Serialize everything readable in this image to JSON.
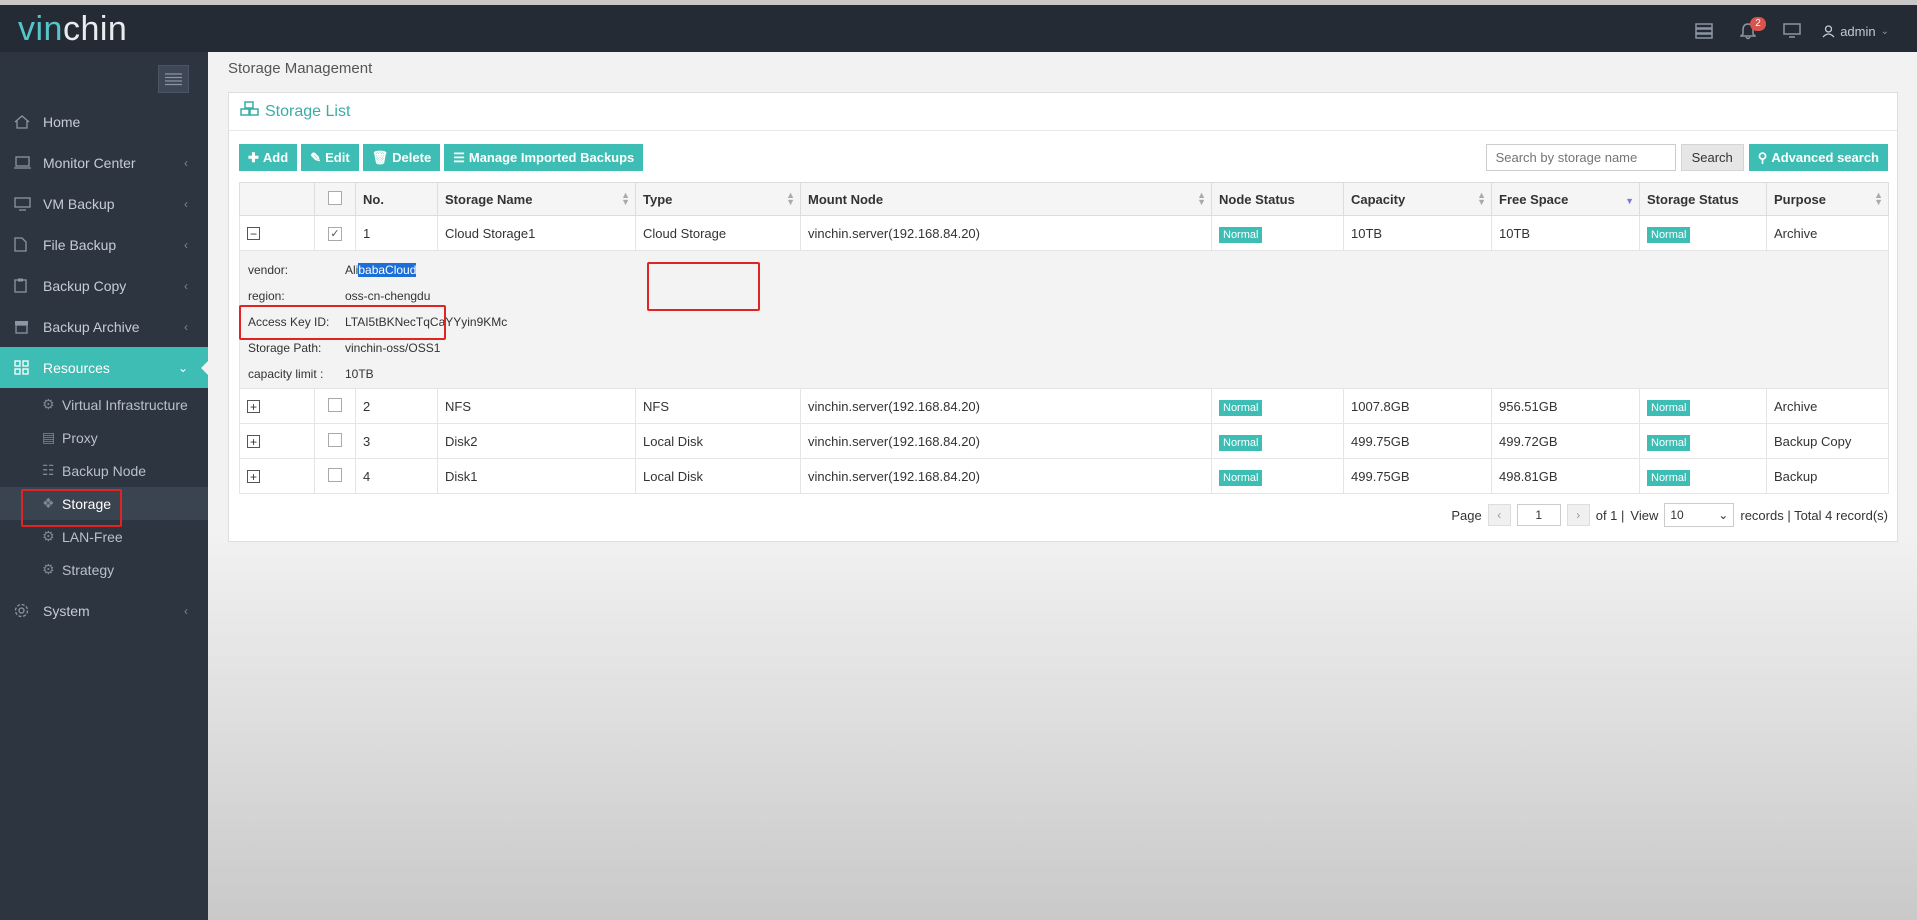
{
  "brand": {
    "part1": "vin",
    "part2": "chin"
  },
  "topbar": {
    "notification_count": "2",
    "user": "admin"
  },
  "sidebar": {
    "items": [
      {
        "label": "Home"
      },
      {
        "label": "Monitor Center"
      },
      {
        "label": "VM Backup"
      },
      {
        "label": "File Backup"
      },
      {
        "label": "Backup Copy"
      },
      {
        "label": "Backup Archive"
      },
      {
        "label": "Resources"
      },
      {
        "label": "System"
      }
    ],
    "resources_sub": [
      {
        "label": "Virtual Infrastructure"
      },
      {
        "label": "Proxy"
      },
      {
        "label": "Backup Node"
      },
      {
        "label": "Storage"
      },
      {
        "label": "LAN-Free"
      },
      {
        "label": "Strategy"
      }
    ]
  },
  "breadcrumb": "Storage Management",
  "panel": {
    "title": "Storage List"
  },
  "toolbar": {
    "add": "Add",
    "edit": "Edit",
    "delete": "Delete",
    "manage": "Manage Imported Backups"
  },
  "search": {
    "placeholder": "Search by storage name",
    "button": "Search",
    "advanced": "Advanced search"
  },
  "table": {
    "headers": [
      "No.",
      "Storage Name",
      "Type",
      "Mount Node",
      "Node Status",
      "Capacity",
      "Free Space",
      "Storage Status",
      "Purpose"
    ],
    "rows": [
      {
        "no": "1",
        "name": "Cloud Storage1",
        "type": "Cloud Storage",
        "mount": "vinchin.server(192.168.84.20)",
        "node_status": "Normal",
        "capacity": "10TB",
        "free": "10TB",
        "storage_status": "Normal",
        "purpose": "Archive"
      },
      {
        "no": "2",
        "name": "NFS",
        "type": "NFS",
        "mount": "vinchin.server(192.168.84.20)",
        "node_status": "Normal",
        "capacity": "1007.8GB",
        "free": "956.51GB",
        "storage_status": "Normal",
        "purpose": "Archive"
      },
      {
        "no": "3",
        "name": "Disk2",
        "type": "Local Disk",
        "mount": "vinchin.server(192.168.84.20)",
        "node_status": "Normal",
        "capacity": "499.75GB",
        "free": "499.72GB",
        "storage_status": "Normal",
        "purpose": "Backup Copy"
      },
      {
        "no": "4",
        "name": "Disk1",
        "type": "Local Disk",
        "mount": "vinchin.server(192.168.84.20)",
        "node_status": "Normal",
        "capacity": "499.75GB",
        "free": "498.81GB",
        "storage_status": "Normal",
        "purpose": "Backup"
      }
    ],
    "detail": {
      "vendor_key": "vendor:",
      "vendor_pre": "Ali",
      "vendor_sel": "babaCloud",
      "region_key": "region:",
      "region": "oss-cn-chengdu",
      "akid_key": "Access Key ID:",
      "akid": "LTAI5tBKNecTqCaYYyin9KMc",
      "path_key": "Storage Path:",
      "path": "vinchin-oss/OSS1",
      "limit_key": "capacity limit :",
      "limit": "10TB"
    }
  },
  "pager": {
    "page_label": "Page",
    "page": "1",
    "of": "of 1 |",
    "view": "View",
    "per_page": "10",
    "records": "records | Total 4 record(s)"
  }
}
